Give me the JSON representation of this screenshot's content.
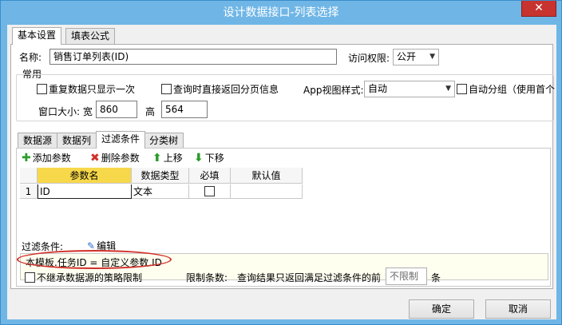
{
  "window": {
    "title": "设计数据接口-列表选择",
    "close": "✕"
  },
  "main_tabs": [
    "基本设置",
    "填表公式"
  ],
  "name": {
    "label": "名称:",
    "value": "销售订单列表(ID)"
  },
  "access": {
    "label": "访问权限:",
    "value": "公开"
  },
  "common": {
    "group_label": "常用",
    "repeat_label": "重复数据只显示一次",
    "direct_page_label": "查询时直接返回分页信息",
    "app_style_label": "App视图样式:",
    "app_style_value": "自动",
    "auto_group_label": "自动分组（使用首个",
    "window_size_label": "窗口大小: 宽",
    "width_value": "860",
    "height_label": "高",
    "height_value": "564"
  },
  "sub_tabs": [
    "数据源",
    "数据列",
    "过滤条件",
    "分类树"
  ],
  "toolbar": {
    "add": "添加参数",
    "delete": "删除参数",
    "up": "上移",
    "down": "下移"
  },
  "grid": {
    "headers": [
      "参数名",
      "数据类型",
      "必填",
      "默认值"
    ],
    "rows": [
      {
        "num": "1",
        "name": "ID",
        "type": "文本",
        "required": false,
        "default": ""
      }
    ]
  },
  "filter": {
    "label": "过滤条件:",
    "edit": "编辑",
    "expression": "本模板.任务ID = 自定义参数.ID"
  },
  "bottom": {
    "inherit_label": "不继承数据源的策略限制",
    "limit_label": "限制条数:",
    "limit_desc": "查询结果只返回满足过滤条件的前",
    "limit_value": "不限制",
    "limit_unit": "条"
  },
  "buttons": {
    "ok": "确定",
    "cancel": "取消"
  },
  "colors": {
    "title_bar": "#6fb6e6",
    "close": "#c7332f",
    "selected_header": "#f7d84b",
    "highlight_circle": "#d0302a",
    "filter_bg": "#fffff0"
  }
}
